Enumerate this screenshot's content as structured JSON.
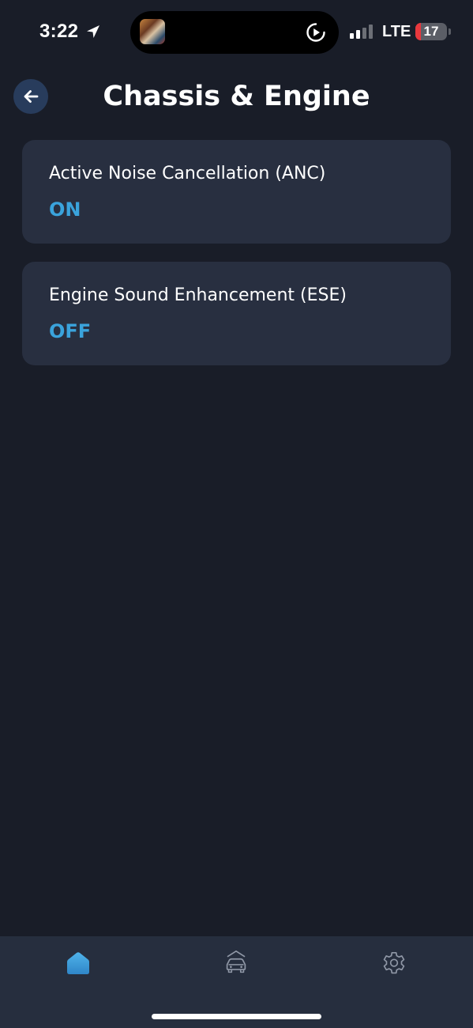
{
  "status_bar": {
    "time": "3:22",
    "network": "LTE",
    "battery_level": "17",
    "battery_fraction": 0.17,
    "icons": [
      "location-arrow-icon",
      "now-playing-artwork",
      "play-icon",
      "cellular-signal-icon",
      "battery-icon"
    ]
  },
  "header": {
    "back_icon": "arrow-left-icon",
    "title": "Chassis & Engine"
  },
  "settings": [
    {
      "name": "Active Noise Cancellation (ANC)",
      "state": "ON"
    },
    {
      "name": "Engine Sound Enhancement (ESE)",
      "state": "OFF"
    }
  ],
  "bottom_nav": {
    "items": [
      {
        "icon": "home-icon",
        "active": true
      },
      {
        "icon": "car-icon",
        "active": false
      },
      {
        "icon": "gear-icon",
        "active": false
      }
    ]
  },
  "colors": {
    "background": "#191d28",
    "card": "#282f40",
    "accent": "#3aa3dc",
    "nav_bar": "#262e3e",
    "back_button": "#283c5c",
    "battery_low": "#e8383d"
  }
}
